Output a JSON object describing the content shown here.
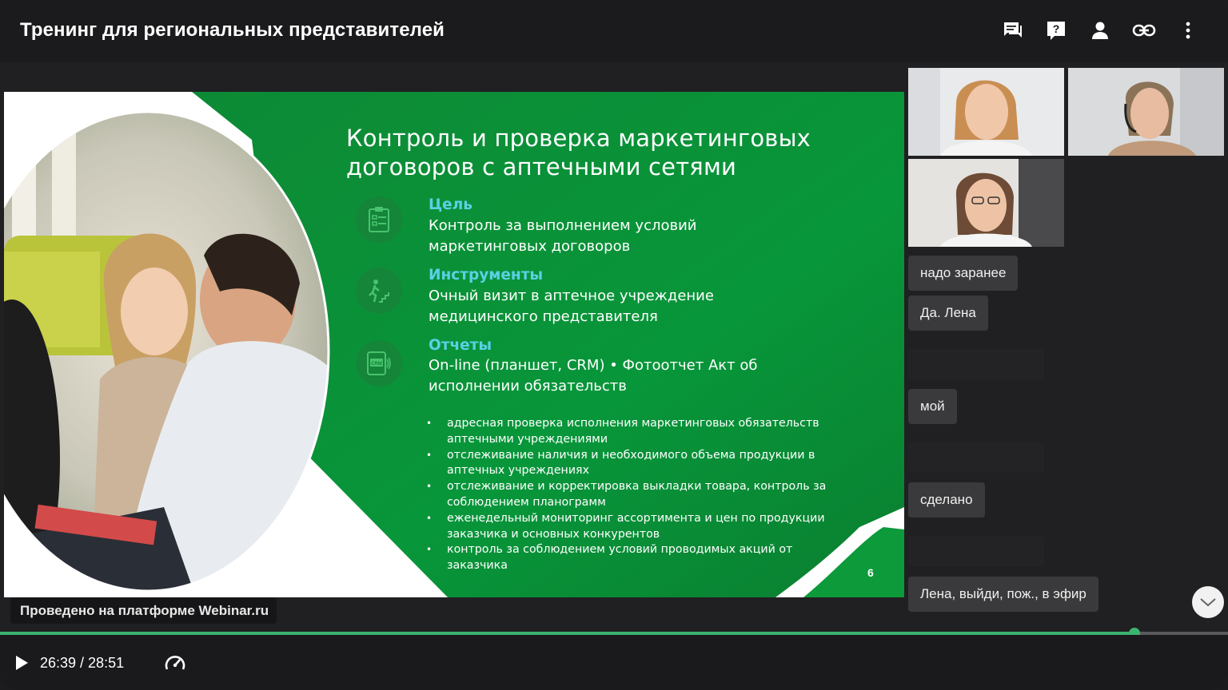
{
  "header": {
    "title": "Тренинг для региональных представителей"
  },
  "header_icons": [
    "chat-icon",
    "question-icon",
    "person-icon",
    "link-icon",
    "more-vertical-icon"
  ],
  "slide": {
    "title": "Контроль и проверка маркетинговых договоров с аптечными сетями",
    "sections": [
      {
        "icon": "checklist-icon",
        "heading": "Цель",
        "body": "Контроль за выполнением условий маркетинговых договоров"
      },
      {
        "icon": "stairs-walker-icon",
        "heading": "Инструменты",
        "body": "Очный визит в аптечное учреждение медицинского представителя"
      },
      {
        "icon": "tablet-crm-icon",
        "heading": "Отчеты",
        "body": "On-line (планшет, CRM) • Фотоотчет Акт об исполнении обязательств"
      }
    ],
    "bullets": [
      "адресная проверка исполнения маркетинговых обязательств аптечными учреждениями",
      "отслеживание наличия и необходимого объема продукции в аптечных учреждениях",
      "отслеживание и корректировка выкладки товара, контроль за соблюдением планограмм",
      "еженедельный мониторинг ассортимента и цен по продукции заказчика и основных конкурентов",
      "контроль за соблюдением условий проводимых акций от заказчика"
    ],
    "page_number": "6",
    "colors": {
      "green": "#0a8c36",
      "accent_heading": "#5ad1e6"
    }
  },
  "platform_badge": "Проведено на платформе Webinar.ru",
  "chat": {
    "messages": [
      "надо заранее",
      "Да. Лена",
      "мой",
      "сделано",
      "Лена, выйди, пож., в эфир"
    ]
  },
  "player": {
    "time": "26:39 / 28:51",
    "progress_fraction": 0.924,
    "accent": "#3cb371"
  }
}
